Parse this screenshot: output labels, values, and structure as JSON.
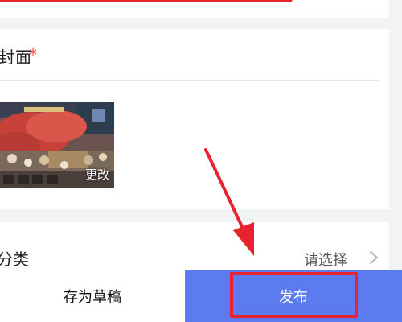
{
  "cover": {
    "label": "封面",
    "required_mark": "*",
    "change_label": "更改"
  },
  "category": {
    "label": "分类",
    "value": "请选择",
    "chevron_icon": "chevron-right-icon"
  },
  "footer": {
    "draft_label": "存为草稿",
    "publish_label": "发布"
  },
  "colors": {
    "primary": "#5b7bef",
    "required": "#e8463a",
    "annotation": "#e8232f"
  }
}
